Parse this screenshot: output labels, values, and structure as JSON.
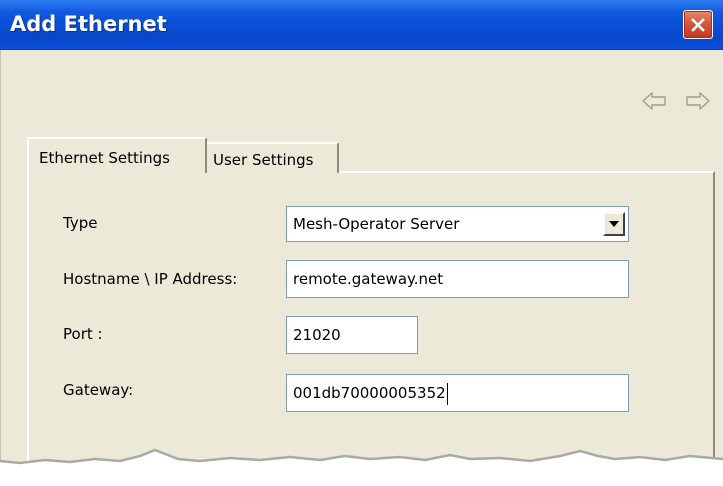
{
  "window": {
    "title": "Add Ethernet",
    "close_icon": "close-x-icon"
  },
  "nav": {
    "back_icon": "arrow-left-icon",
    "forward_icon": "arrow-right-icon"
  },
  "tabs": [
    {
      "label": "Ethernet Settings",
      "selected": true
    },
    {
      "label": "User Settings",
      "selected": false
    }
  ],
  "form": {
    "type": {
      "label": "Type",
      "value": "Mesh-Operator Server"
    },
    "hostname": {
      "label": "Hostname \\ IP Address:",
      "value": "remote.gateway.net"
    },
    "port": {
      "label": "Port :",
      "value": "21020"
    },
    "gateway": {
      "label": "Gateway:",
      "value": "001db70000005352"
    }
  },
  "colors": {
    "titlebar": "#0a4fd7",
    "close_button": "#d4553b",
    "dialog_background": "#ece9d8",
    "field_border": "#7f9db9"
  }
}
